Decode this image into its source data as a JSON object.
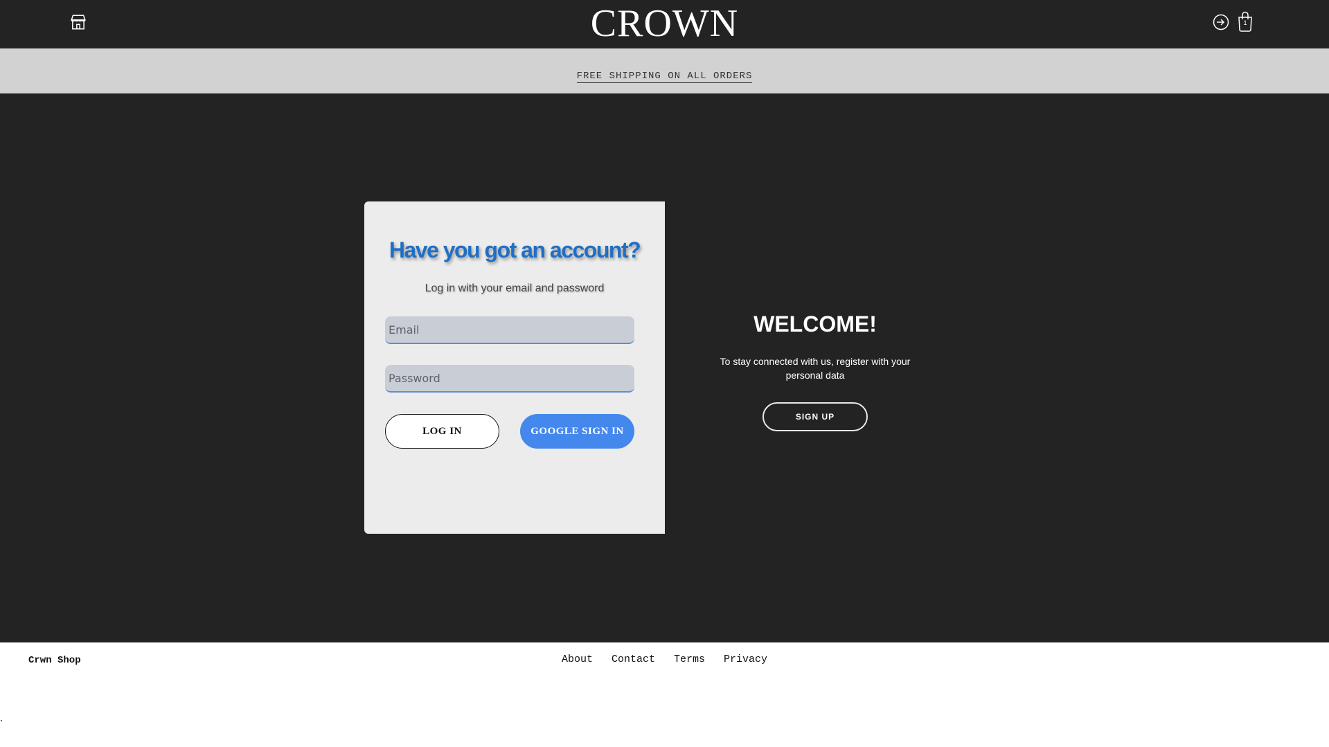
{
  "header": {
    "brand": "CROWN",
    "shop_icon": "shop-icon",
    "login_icon": "login-icon",
    "cart_icon": "shopping-bag-icon",
    "cart_count": "1"
  },
  "announcement": {
    "text": "FREE SHIPPING ON ALL ORDERS"
  },
  "login_card": {
    "title": "Have you got an account?",
    "subtitle": "Log in with your email and password",
    "email_placeholder": "Email",
    "password_placeholder": "Password",
    "login_button": "LOG IN",
    "google_button": "GOOGLE SIGN IN"
  },
  "welcome_panel": {
    "heading": "WELCOME!",
    "text": "To stay connected with us, register with your personal data",
    "signup_button": "SIGN UP"
  },
  "footer": {
    "brand": "Crwn Shop",
    "links": [
      "About",
      "Contact",
      "Terms",
      "Privacy"
    ]
  },
  "colors": {
    "header_bg": "#232323",
    "announcement_bg": "#d2d2d2",
    "title_blue": "#1f6fc5",
    "google_blue": "#4488ee"
  }
}
